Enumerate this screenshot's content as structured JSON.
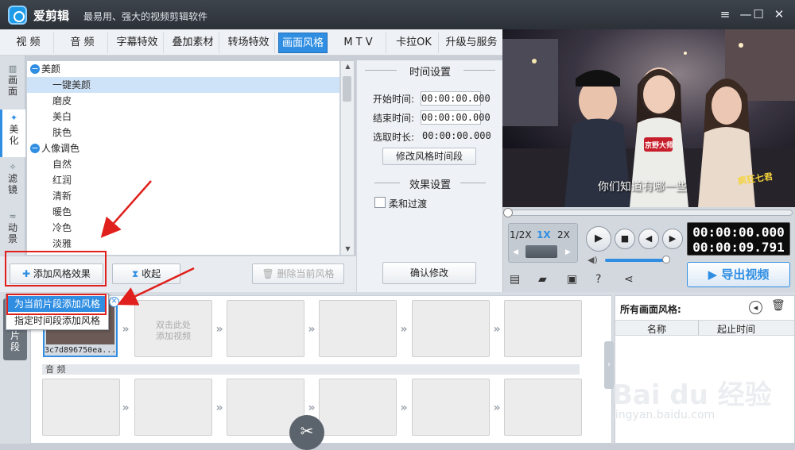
{
  "app": {
    "name": "爱剪辑",
    "slogan": "最易用、强大的视频剪辑软件"
  },
  "window_controls": {
    "menu": "≡",
    "minimize": "—",
    "maximize": "☐",
    "close": "✕"
  },
  "tabs": [
    {
      "label": "视  频"
    },
    {
      "label": "音  频"
    },
    {
      "label": "字幕特效"
    },
    {
      "label": "叠加素材"
    },
    {
      "label": "转场特效"
    },
    {
      "label": "画面风格"
    },
    {
      "label": "M T V"
    },
    {
      "label": "卡拉OK"
    },
    {
      "label": "升级与服务"
    }
  ],
  "side_tabs": [
    {
      "label": "画\n面",
      "icon": "film-icon"
    },
    {
      "label": "美\n化",
      "icon": "magic-wand-icon"
    },
    {
      "label": "滤\n镜",
      "icon": "sparkle-icon"
    },
    {
      "label": "动\n景",
      "icon": "wave-icon"
    }
  ],
  "style_list": {
    "categories": [
      {
        "label": "美颜",
        "items": [
          "一键美颜",
          "磨皮",
          "美白",
          "肤色"
        ]
      },
      {
        "label": "人像调色",
        "items": [
          "自然",
          "红润",
          "清新",
          "暖色",
          "冷色",
          "淡雅"
        ]
      }
    ],
    "selected": "一键美颜"
  },
  "list_buttons": {
    "add": "添加风格效果",
    "collapse": "收起",
    "delete": "删除当前风格"
  },
  "context_menu": {
    "item1": "为当前片段添加风格",
    "item2": "指定时间段添加风格"
  },
  "time_settings": {
    "title": "时间设置",
    "start_label": "开始时间:",
    "start_value": "00:00:00.000",
    "end_label": "结束时间:",
    "end_value": "00:00:00.000",
    "duration_label": "选取时长:",
    "duration_value": "00:00:00.000",
    "modify_button": "修改风格时间段"
  },
  "effect_settings": {
    "title": "效果设置",
    "soft_transition": "柔和过渡",
    "confirm_button": "确认修改"
  },
  "preview": {
    "subtitle": "你们知道有哪一些",
    "mic_text": "京野大师",
    "logo_text": "疯狂七君"
  },
  "player": {
    "speed_half": "1/2X",
    "speed_1x": "1X",
    "speed_2x": "2X",
    "time_current": "00:00:00.000",
    "time_total": "00:00:09.791",
    "export_button": "导出视频"
  },
  "timeline": {
    "clip_filename": "3c7d896750ea...",
    "empty_clip_text": "双击此处\n添加视频",
    "audio_label": "音 频",
    "segment_tab": "片\n段"
  },
  "right_panel": {
    "title": "所有画面风格:",
    "col_name": "名称",
    "col_time": "起止时间"
  },
  "watermark": {
    "text": "Bai du 经验",
    "url": "jingyan.baidu.com"
  },
  "colors": {
    "accent": "#2f8ee2",
    "annotation_red": "#e0201c",
    "title_bar": "#353a41"
  }
}
